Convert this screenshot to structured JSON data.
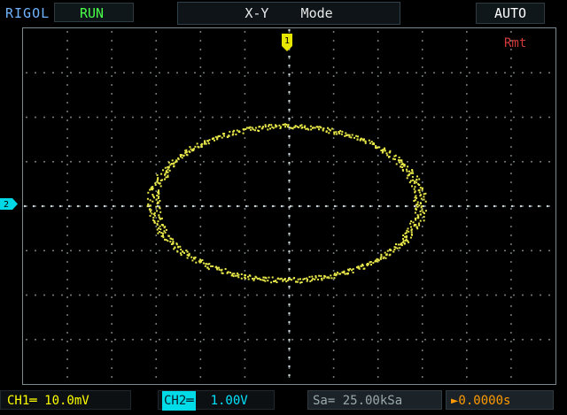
{
  "header": {
    "brand": "RIGOL",
    "run_status": "RUN",
    "mode": "X-Y    Mode",
    "trigger_mode": "AUTO"
  },
  "screen": {
    "remote_indicator": "Rmt",
    "ch1_marker": "1",
    "ch2_marker": "2",
    "trace_color": "#e8e84a"
  },
  "footer": {
    "ch1": "CH1═ 10.0mV",
    "ch2_tag": "CH2═",
    "ch2_value": "  1.00V",
    "sample_rate": "Sa= 25.00kSa",
    "trigger_offset": "►0.0000s"
  },
  "colors": {
    "ch1": "#ffff00",
    "ch2": "#00e5ff",
    "run": "#49ff49",
    "brand": "#6fb3ff",
    "remote": "#d23a3a",
    "trigger": "#ff9a00"
  }
}
